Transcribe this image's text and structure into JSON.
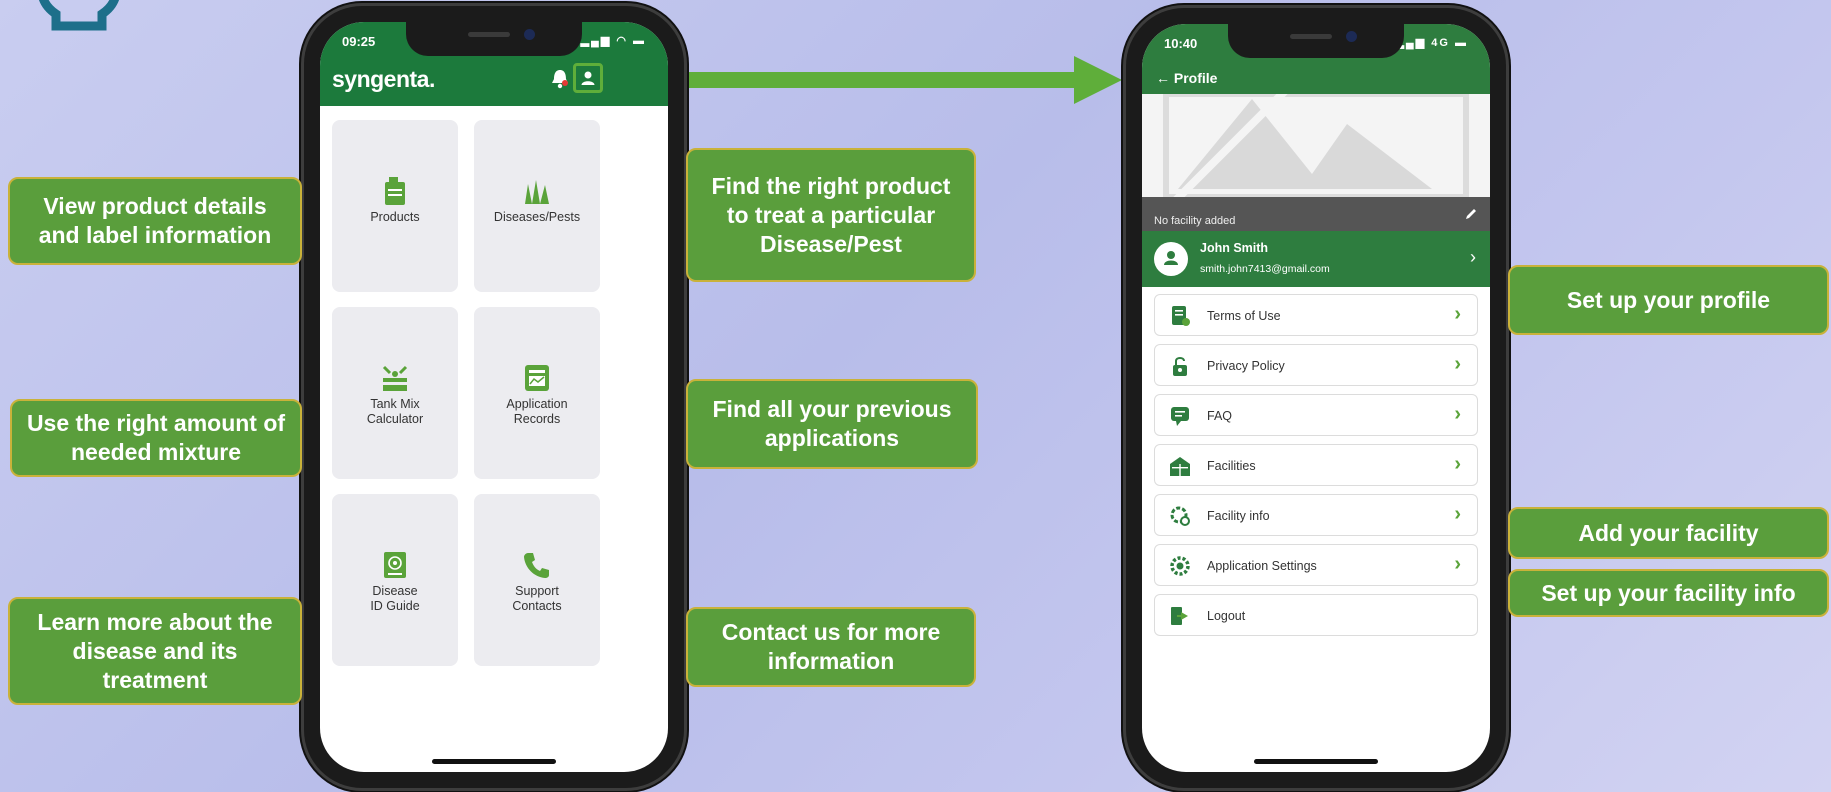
{
  "colors": {
    "accent": "#5a9e3c",
    "header_green": "#1c7a3c",
    "icon_green": "#5aa33a"
  },
  "phone_home": {
    "status": {
      "time": "09:25"
    },
    "header": {
      "logo": "syngenta."
    },
    "tiles": [
      {
        "label": "Products",
        "icon": "jerrycan-icon"
      },
      {
        "label": "Diseases/Pests",
        "icon": "plants-icon"
      },
      {
        "label": "Tank Mix\nCalculator",
        "icon": "sprayer-icon"
      },
      {
        "label": "Application\nRecords",
        "icon": "records-icon"
      },
      {
        "label": "Disease\nID Guide",
        "icon": "guide-book-icon"
      },
      {
        "label": "Support\nContacts",
        "icon": "phone-icon"
      }
    ]
  },
  "phone_profile": {
    "status": {
      "time": "10:40",
      "network": "4G"
    },
    "header": {
      "back_label": "← Profile"
    },
    "facility_banner": {
      "label": "No facility added"
    },
    "user": {
      "name": "John Smith",
      "email": "smith.john7413@gmail.com"
    },
    "menu": [
      {
        "label": "Terms of Use",
        "icon": "document-icon"
      },
      {
        "label": "Privacy Policy",
        "icon": "lock-icon"
      },
      {
        "label": "FAQ",
        "icon": "chat-icon"
      },
      {
        "label": "Facilities",
        "icon": "greenhouse-icon"
      },
      {
        "label": "Facility info",
        "icon": "facility-settings-icon"
      },
      {
        "label": "Application Settings",
        "icon": "gear-icon"
      },
      {
        "label": "Logout",
        "icon": "logout-icon"
      }
    ]
  },
  "callouts": {
    "products": "View product details and label information",
    "mixture": "Use the right amount of needed mixture",
    "disease_guide": "Learn more about the disease and its treatment",
    "diseases": "Find the right product to treat a particular Disease/Pest",
    "records": "Find all your previous applications",
    "contact": "Contact us for more information",
    "profile": "Set up your profile",
    "facility": "Add your facility",
    "facility_info": "Set up your facility info"
  }
}
